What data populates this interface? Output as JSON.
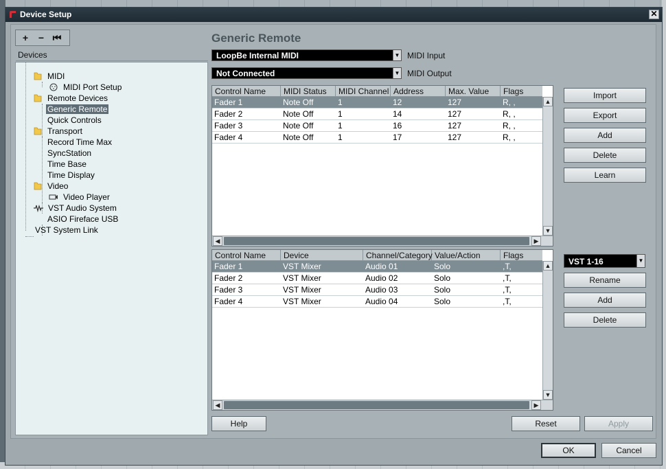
{
  "window": {
    "title": "Device Setup",
    "close_glyph": "✕"
  },
  "toolbar": {
    "add": "+",
    "remove": "−",
    "reset": "⏮"
  },
  "tree": {
    "header": "Devices",
    "items": [
      {
        "label": "MIDI",
        "icon": "folder-icon"
      },
      {
        "label": "MIDI Port Setup",
        "icon": "midi-port-icon"
      },
      {
        "label": "Remote Devices",
        "icon": "folder-icon"
      },
      {
        "label": "Generic Remote",
        "selected": true
      },
      {
        "label": "Quick Controls"
      },
      {
        "label": "Transport",
        "icon": "folder-icon"
      },
      {
        "label": "Record Time Max"
      },
      {
        "label": "SyncStation"
      },
      {
        "label": "Time Base"
      },
      {
        "label": "Time Display"
      },
      {
        "label": "Video",
        "icon": "folder-icon"
      },
      {
        "label": "Video Player",
        "icon": "video-icon"
      },
      {
        "label": "VST Audio System",
        "icon": "audio-system-icon"
      },
      {
        "label": "ASIO Fireface USB"
      },
      {
        "label": "VST System Link"
      }
    ]
  },
  "main": {
    "heading": "Generic Remote",
    "midi_input": {
      "value": "LoopBe Internal MIDI",
      "label": "MIDI Input"
    },
    "midi_output": {
      "value": "Not Connected",
      "label": "MIDI Output"
    },
    "table1": {
      "columns": [
        "Control Name",
        "MIDI Status",
        "MIDI Channel",
        "Address",
        "Max. Value",
        "Flags"
      ],
      "rows": [
        [
          "Fader 1",
          "Note Off",
          "1",
          "12",
          "127",
          "R, ,"
        ],
        [
          "Fader 2",
          "Note Off",
          "1",
          "14",
          "127",
          "R, ,"
        ],
        [
          "Fader 3",
          "Note Off",
          "1",
          "16",
          "127",
          "R, ,"
        ],
        [
          "Fader 4",
          "Note Off",
          "1",
          "17",
          "127",
          "R, ,"
        ]
      ]
    },
    "table2": {
      "columns": [
        "Control Name",
        "Device",
        "Channel/Category",
        "Value/Action",
        "Flags"
      ],
      "rows": [
        [
          "Fader 1",
          "VST Mixer",
          "Audio 01",
          "Solo",
          ",T,"
        ],
        [
          "Fader 2",
          "VST Mixer",
          "Audio 02",
          "Solo",
          ",T,"
        ],
        [
          "Fader 3",
          "VST Mixer",
          "Audio 03",
          "Solo",
          ",T,"
        ],
        [
          "Fader 4",
          "VST Mixer",
          "Audio 04",
          "Solo",
          ",T,"
        ]
      ]
    },
    "bank": {
      "value": "VST 1-16"
    }
  },
  "buttons": {
    "import": "Import",
    "export": "Export",
    "add1": "Add",
    "delete1": "Delete",
    "learn": "Learn",
    "rename": "Rename",
    "add2": "Add",
    "delete2": "Delete",
    "help": "Help",
    "reset": "Reset",
    "apply": "Apply",
    "ok": "OK",
    "cancel": "Cancel"
  },
  "scroll_glyphs": {
    "up": "▲",
    "down": "▼",
    "left": "◀",
    "right": "▶",
    "combo": "▼"
  }
}
